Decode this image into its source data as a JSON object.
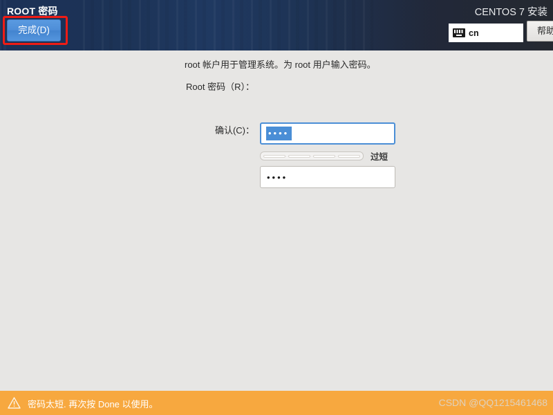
{
  "header": {
    "page_title": "ROOT 密码",
    "product_title": "CENTOS 7 安装",
    "done_label": "完成(D)",
    "help_label": "帮助",
    "keyboard_layout": "cn",
    "keyboard_icon": "keyboard-icon",
    "annotation_color": "#f01c15",
    "accent_color": "#4a8ed6"
  },
  "main": {
    "description": "root 帐户用于管理系统。为 root 用户输入密码。",
    "password": {
      "label": "Root 密码（R）：",
      "value": "••••",
      "placeholder": ""
    },
    "confirm": {
      "label": "确认(C)：",
      "value": "••••",
      "placeholder": ""
    },
    "strength": {
      "label": "过短",
      "segments_total": 4,
      "segments_filled": 0
    }
  },
  "footer": {
    "warning_icon": "warning-triangle-icon",
    "warning_text": "密码太短. 再次按 Done 以使用。",
    "watermark": "CSDN @QQ1215461468",
    "background_color": "#f7a83f"
  }
}
